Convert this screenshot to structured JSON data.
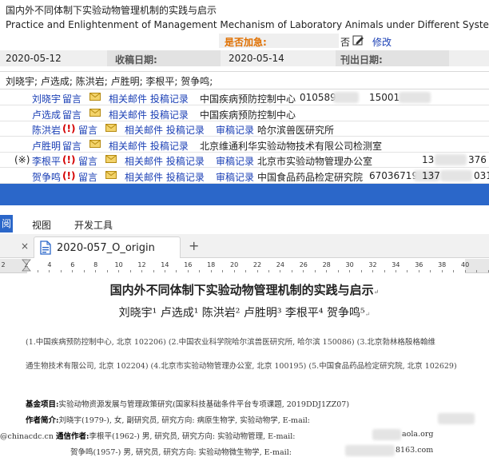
{
  "article": {
    "title_zh": "国内外不同体制下实验动物管理机制的实践与启示",
    "title_en": "Practice and Enlightenment of Management Mechanism of Laboratory Animals under Different Systems at Home and Abroad",
    "urgent_label": "是否加急:",
    "urgent_value": "否",
    "modify_label": "修改",
    "submit_date": "2020-05-12",
    "received_label": "收稿日期:",
    "received_date": "2020-05-14",
    "published_label": "刊出日期:",
    "authors_line": "刘晓宇; 卢选成; 陈洪岩; 卢胜明; 李根平; 贺争鸣;"
  },
  "author_rows": [
    {
      "prefix": "",
      "name": "刘晓宇",
      "flag": "",
      "note": "留言",
      "links": "相关邮件 投稿记录",
      "review": "",
      "org": "中国疾病预防控制中心",
      "phone": "010589",
      "mobile": "15001"
    },
    {
      "prefix": "",
      "name": "卢选成",
      "flag": "",
      "note": "留言",
      "links": "相关邮件 投稿记录",
      "review": "",
      "org": "中国疾病预防控制中心",
      "phone": "",
      "mobile": ""
    },
    {
      "prefix": "",
      "name": "陈洪岩",
      "flag": "(!)",
      "note": "留言",
      "links": "相关邮件 投稿记录",
      "review": "审稿记录",
      "org": "哈尔滨兽医研究所",
      "phone": "",
      "mobile": ""
    },
    {
      "prefix": "",
      "name": "卢胜明",
      "flag": "",
      "note": "留言",
      "links": "相关邮件 投稿记录",
      "review": "",
      "org": "北京维通利华实验动物技术有限公司检测室",
      "phone": "",
      "mobile": ""
    },
    {
      "prefix": "(※)",
      "name": "李根平",
      "flag": "(!)",
      "note": "留言",
      "links": "相关邮件 投稿记录",
      "review": "审稿记录",
      "org": "北京市实验动物管理办公室",
      "phone": "",
      "mobile": "13",
      "mobile_tail": "376"
    },
    {
      "prefix": "",
      "name": "贺争鸣",
      "flag": "(!)",
      "note": "留言",
      "links": "相关邮件 投稿记录",
      "review": "审稿记录",
      "org": "中国食品药品检定研究院",
      "phone": "67036719",
      "mobile": "137",
      "mobile_tail": "031"
    }
  ],
  "editor": {
    "menu_active": "阅",
    "menu_view": "视图",
    "menu_dev": "开发工具",
    "tab_name": "2020-057_O_origin",
    "tab_close": "×",
    "tab_add": "+",
    "ruler_numbers": [
      "2",
      "2",
      "4",
      "6",
      "8",
      "10",
      "12",
      "14",
      "16",
      "18",
      "20",
      "22",
      "24",
      "26",
      "28",
      "30",
      "32",
      "34",
      "36",
      "38",
      "40"
    ]
  },
  "document": {
    "title": "国内外不同体制下实验动物管理机制的实践与启示",
    "authors": "刘晓宇¹  卢选成¹  陈洪岩²  卢胜明³  李根平⁴  贺争鸣⁵",
    "affil_1": "(1.中国疾病预防控制中心, 北京 102206) (2.中国农业科学院哈尔滨兽医研究所, 哈尔滨 150086) (3.北京勃林格殷格翰维",
    "affil_2": "通生物技术有限公司, 北京 102204) (4.北京市实验动物管理办公室, 北京 100195) (5.中国食品药品检定研究院, 北京 102629)",
    "fund_label": "基金项目:",
    "fund_text": "实验动物资源发展与管理政策研究(国家科技基础条件平台专项课题, 2019DDJ1ZZ07)",
    "bio_label": "作者简介:",
    "bio_text": "刘晓宇(1979-), 女, 副研究员, 研究方向: 病原生物学, 实验动物学, E-mail:",
    "email_1": "@chinacdc.cn",
    "corr_label": "通信作者:",
    "corr_text": "李根平(1962-) 男, 研究员, 研究方向: 实验动物管理, E-mail:",
    "email_2_tail": "aola.org",
    "he_text": "贺争鸣(1957-) 男, 研究员, 研究方向: 实验动物微生物学, E-mail:",
    "email_3_tail": "8163.com"
  },
  "colors": {
    "accent_blue": "#2b67c9",
    "link_blue": "#1a3fb5",
    "urgent_orange": "#e07000",
    "flag_red": "#d40000"
  }
}
